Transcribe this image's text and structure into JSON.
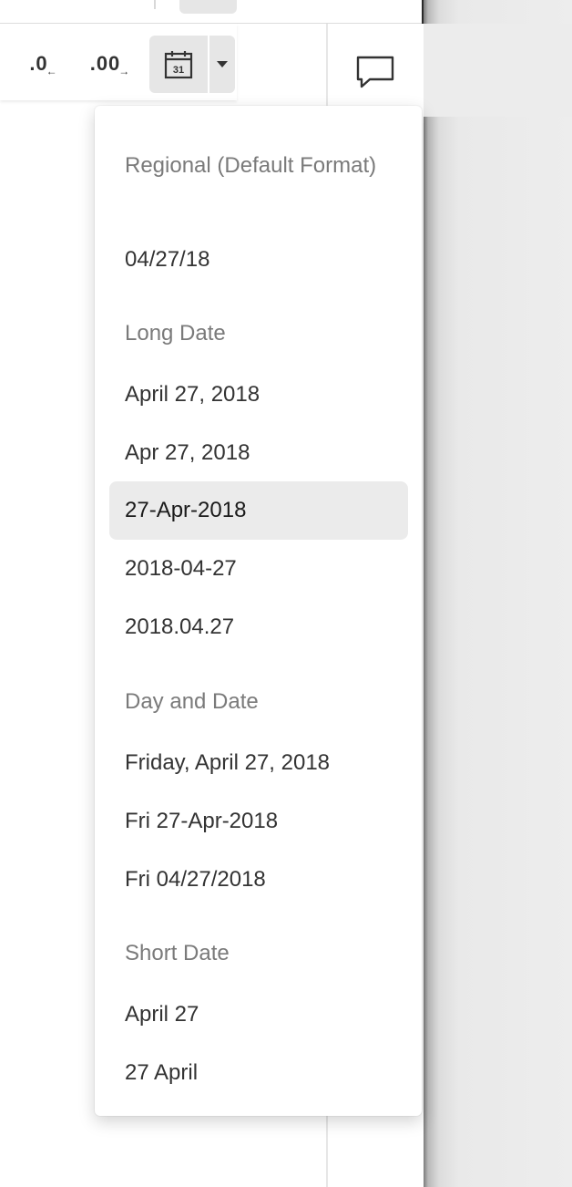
{
  "toolbar": {
    "decrease_decimals_label": ".0",
    "increase_decimals_label": ".00",
    "date_format_icon_day": "31",
    "date_format_icon": "calendar-icon",
    "caret_icon": "caret-down-icon",
    "comment_icon": "comment-icon"
  },
  "date_format_menu": {
    "selected_index": 3,
    "sections": [
      {
        "heading": "Regional (Default Format)",
        "items": [
          "04/27/18"
        ]
      },
      {
        "heading": "Long Date",
        "items": [
          "April 27, 2018",
          "Apr 27, 2018",
          "27-Apr-2018",
          "2018-04-27",
          "2018.04.27"
        ]
      },
      {
        "heading": "Day and Date",
        "items": [
          "Friday, April 27, 2018",
          "Fri 27-Apr-2018",
          "Fri 04/27/2018"
        ]
      },
      {
        "heading": "Short Date",
        "items": [
          "April 27",
          "27 April"
        ]
      }
    ]
  },
  "colors": {
    "selected_bg": "#ebebeb",
    "heading_text": "#7a7a7a",
    "item_text": "#333333"
  }
}
